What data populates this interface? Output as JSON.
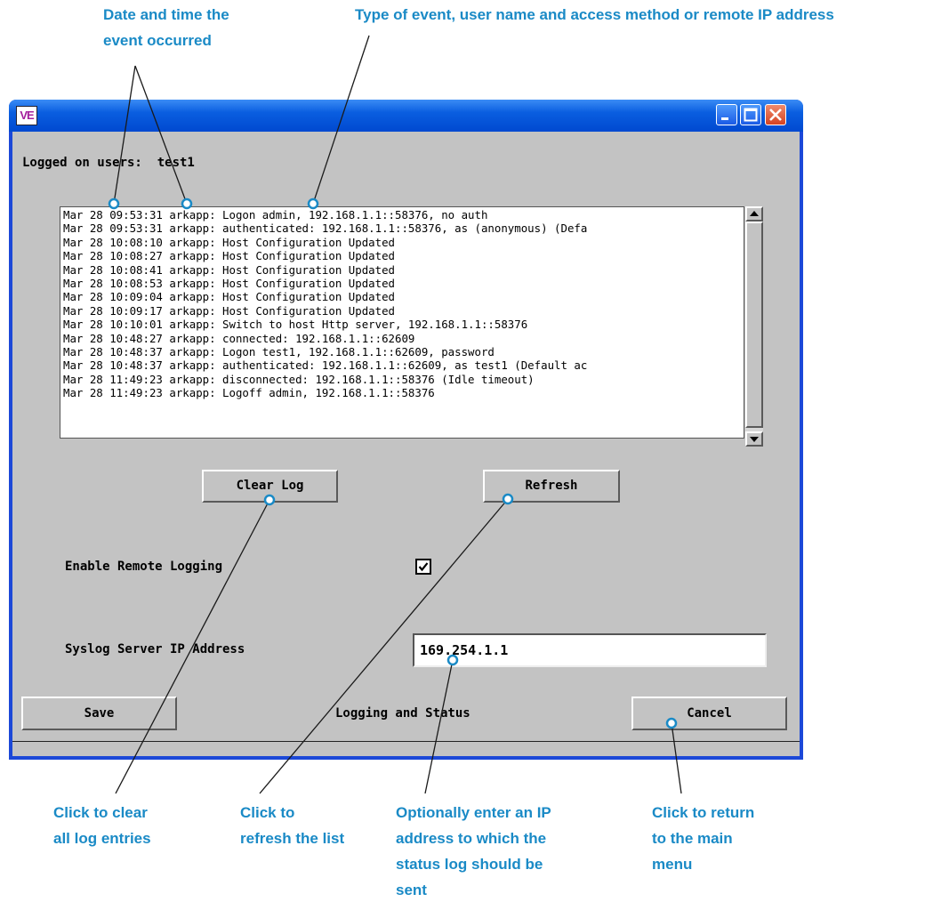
{
  "annotations": {
    "top_left": [
      "Date and time the",
      "event occurred"
    ],
    "top_right": "Type of event, user name and access method or remote IP address",
    "bottom_clear": [
      "Click to clear",
      "all log entries"
    ],
    "bottom_refresh": [
      "Click to",
      "refresh the list"
    ],
    "bottom_ip": [
      "Optionally enter an IP",
      "address to which the",
      "status log should be",
      "sent"
    ],
    "bottom_cancel": [
      "Click to return",
      "to the main",
      "menu"
    ]
  },
  "window": {
    "icon_text": "VE",
    "logged_on_label": "Logged on users:",
    "logged_on_users": "test1"
  },
  "log": {
    "lines": [
      "Mar 28 09:53:31 arkapp: Logon admin, 192.168.1.1::58376, no auth",
      "Mar 28 09:53:31 arkapp: authenticated: 192.168.1.1::58376, as (anonymous) (Defa",
      "Mar 28 10:08:10 arkapp: Host Configuration Updated",
      "Mar 28 10:08:27 arkapp: Host Configuration Updated",
      "Mar 28 10:08:41 arkapp: Host Configuration Updated",
      "Mar 28 10:08:53 arkapp: Host Configuration Updated",
      "Mar 28 10:09:04 arkapp: Host Configuration Updated",
      "Mar 28 10:09:17 arkapp: Host Configuration Updated",
      "Mar 28 10:10:01 arkapp: Switch to host Http server, 192.168.1.1::58376",
      "Mar 28 10:48:27 arkapp: connected: 192.168.1.1::62609",
      "Mar 28 10:48:37 arkapp: Logon test1, 192.168.1.1::62609, password",
      "Mar 28 10:48:37 arkapp: authenticated: 192.168.1.1::62609, as test1 (Default ac",
      "Mar 28 11:49:23 arkapp: disconnected: 192.168.1.1::58376 (Idle timeout)",
      "Mar 28 11:49:23 arkapp: Logoff admin, 192.168.1.1::58376"
    ]
  },
  "buttons": {
    "clear_log": "Clear Log",
    "refresh": "Refresh",
    "save": "Save",
    "cancel": "Cancel"
  },
  "remote_logging": {
    "label": "Enable Remote Logging",
    "checked": true
  },
  "syslog": {
    "label": "Syslog Server IP Address",
    "value": "169.254.1.1"
  },
  "status_title": "Logging and Status",
  "colors": {
    "callout": "#1a8ac6",
    "client_bg": "#c3c3c3",
    "titlebar": "#0a5ee0",
    "close_button": "#d44322"
  }
}
